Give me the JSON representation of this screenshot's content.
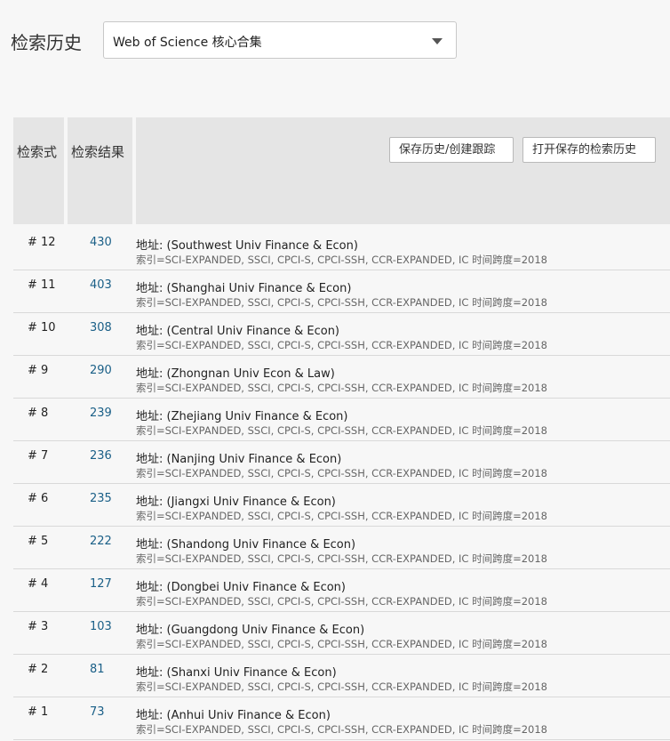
{
  "header": {
    "title": "检索历史",
    "database_selected": "Web of Science 核心合集"
  },
  "table": {
    "col_query_label": "检索式",
    "col_results_label": "检索结果",
    "save_button": "保存历史/创建跟踪",
    "open_button": "打开保存的检索历史",
    "rows": [
      {
        "num": "# 12",
        "count": "430",
        "query": "地址: (Southwest Univ Finance & Econ)",
        "meta": "索引=SCI-EXPANDED, SSCI, CPCI-S, CPCI-SSH, CCR-EXPANDED, IC 时间跨度=2018"
      },
      {
        "num": "# 11",
        "count": "403",
        "query": "地址: (Shanghai Univ Finance & Econ)",
        "meta": "索引=SCI-EXPANDED, SSCI, CPCI-S, CPCI-SSH, CCR-EXPANDED, IC 时间跨度=2018"
      },
      {
        "num": "# 10",
        "count": "308",
        "query": "地址: (Central Univ Finance & Econ)",
        "meta": "索引=SCI-EXPANDED, SSCI, CPCI-S, CPCI-SSH, CCR-EXPANDED, IC 时间跨度=2018"
      },
      {
        "num": "# 9",
        "count": "290",
        "query": "地址: (Zhongnan Univ Econ & Law)",
        "meta": "索引=SCI-EXPANDED, SSCI, CPCI-S, CPCI-SSH, CCR-EXPANDED, IC 时间跨度=2018"
      },
      {
        "num": "# 8",
        "count": "239",
        "query": "地址: (Zhejiang Univ Finance & Econ)",
        "meta": "索引=SCI-EXPANDED, SSCI, CPCI-S, CPCI-SSH, CCR-EXPANDED, IC 时间跨度=2018"
      },
      {
        "num": "# 7",
        "count": "236",
        "query": "地址: (Nanjing Univ Finance & Econ)",
        "meta": "索引=SCI-EXPANDED, SSCI, CPCI-S, CPCI-SSH, CCR-EXPANDED, IC 时间跨度=2018"
      },
      {
        "num": "# 6",
        "count": "235",
        "query": "地址: (Jiangxi Univ Finance & Econ)",
        "meta": "索引=SCI-EXPANDED, SSCI, CPCI-S, CPCI-SSH, CCR-EXPANDED, IC 时间跨度=2018"
      },
      {
        "num": "# 5",
        "count": "222",
        "query": "地址: (Shandong Univ Finance & Econ)",
        "meta": "索引=SCI-EXPANDED, SSCI, CPCI-S, CPCI-SSH, CCR-EXPANDED, IC 时间跨度=2018"
      },
      {
        "num": "# 4",
        "count": "127",
        "query": "地址: (Dongbei Univ Finance & Econ)",
        "meta": "索引=SCI-EXPANDED, SSCI, CPCI-S, CPCI-SSH, CCR-EXPANDED, IC 时间跨度=2018"
      },
      {
        "num": "# 3",
        "count": "103",
        "query": "地址: (Guangdong Univ Finance & Econ)",
        "meta": "索引=SCI-EXPANDED, SSCI, CPCI-S, CPCI-SSH, CCR-EXPANDED, IC 时间跨度=2018"
      },
      {
        "num": "# 2",
        "count": "81",
        "query": "地址: (Shanxi Univ Finance & Econ)",
        "meta": "索引=SCI-EXPANDED, SSCI, CPCI-S, CPCI-SSH, CCR-EXPANDED, IC 时间跨度=2018"
      },
      {
        "num": "# 1",
        "count": "73",
        "query": "地址: (Anhui Univ Finance & Econ)",
        "meta": "索引=SCI-EXPANDED, SSCI, CPCI-S, CPCI-SSH, CCR-EXPANDED, IC 时间跨度=2018"
      }
    ]
  },
  "colors": {
    "link": "#1a5f87",
    "header_bg": "#e5e5e5",
    "page_bg": "#f7f7f7"
  }
}
